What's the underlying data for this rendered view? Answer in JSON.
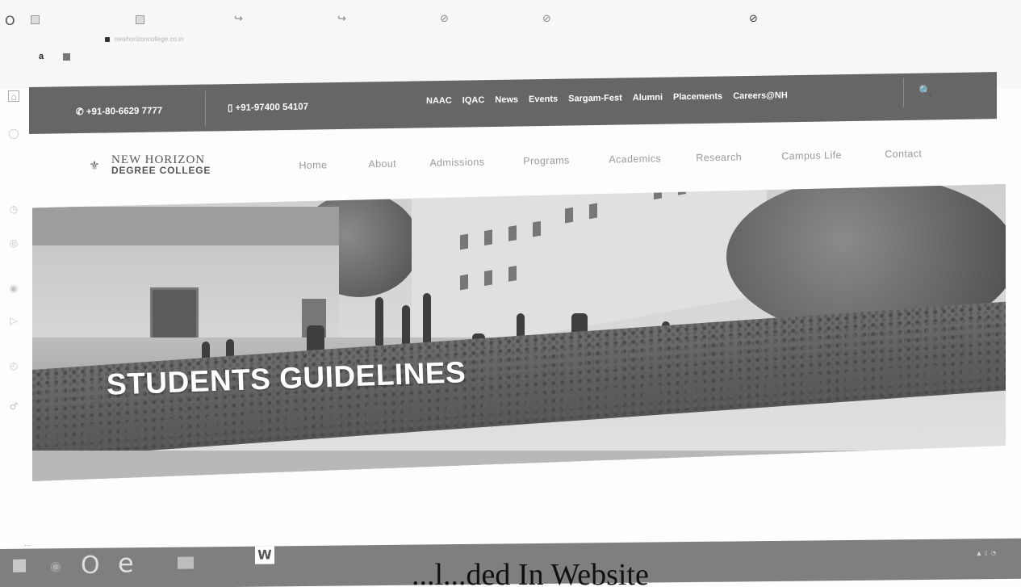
{
  "browser": {
    "logo_glyph": "O",
    "tab_glyphs": [
      "↪",
      "↪",
      "⊘",
      "⊘"
    ],
    "active_tab_glyph": "⊘",
    "url": "newhorizoncollege.co.in",
    "bookmark_letter": "a",
    "sidebar_icons": [
      "home-icon",
      "ring-icon",
      "clock-icon",
      "instagram-icon",
      "circle-icon",
      "play-icon",
      "history-icon",
      "pin-icon"
    ]
  },
  "topbar": {
    "phone": "+91-80-6629 7777",
    "mobile": "+91-97400 54107",
    "links": [
      "NAAC",
      "IQAC",
      "News",
      "Events",
      "Sargam-Fest",
      "Alumni",
      "Placements",
      "Careers@NH"
    ],
    "search_glyph": "🔍"
  },
  "logo": {
    "line1": "NEW HORIZON",
    "line2": "DEGREE COLLEGE"
  },
  "nav": {
    "items": [
      "Home",
      "About",
      "Admissions",
      "Programs",
      "Academics",
      "Research",
      "Campus Life",
      "Contact"
    ]
  },
  "hero": {
    "title": "STUDENTS GUIDELINES"
  },
  "page": {
    "ellipsis": "..."
  },
  "taskbar": {
    "word_label": "W",
    "overlay_text": "...l...ded In Website"
  }
}
